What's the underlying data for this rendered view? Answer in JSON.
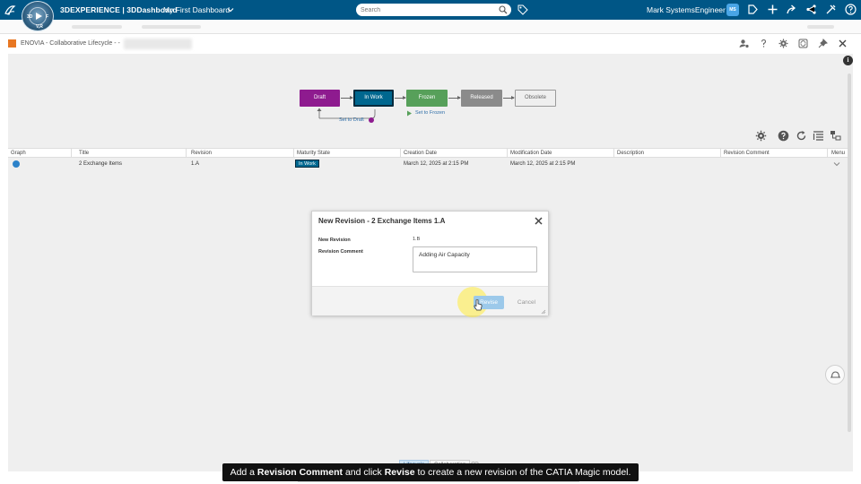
{
  "topbar": {
    "brand": "3DEXPERIENCE | 3DDashboard",
    "dashboard_name": "My First Dashboard",
    "search_placeholder": "Search",
    "username": "Mark SystemsEngineer",
    "avatar_initials": "MS",
    "compass_labels": {
      "left": "3D",
      "right": "F",
      "bottom": "V,R"
    }
  },
  "widget": {
    "title": "ENOVIA - Collaborative Lifecycle - -"
  },
  "lifecycle": {
    "states": [
      "Draft",
      "In Work",
      "Frozen",
      "Released",
      "Obsolete"
    ],
    "current": "In Work",
    "transitions": {
      "to_draft": "Set to Draft",
      "to_frozen": "Set to Frozen"
    }
  },
  "table": {
    "columns": [
      "Graph",
      "Title",
      "Revision",
      "Maturity State",
      "Creation Date",
      "Modification Date",
      "Description",
      "Revision Comment",
      "Menu"
    ],
    "rows": [
      {
        "title": "2 Exchange Items",
        "revision": "1.A",
        "maturity": "In Work",
        "created": "March 12, 2025 at 2:15 PM",
        "modified": "March 12, 2025 at 2:15 PM",
        "description": "",
        "comment": ""
      }
    ]
  },
  "dialog": {
    "title": "New Revision - 2 Exchange Items 1.A",
    "new_revision_label": "New Revision",
    "new_revision_value": "1.B",
    "comment_label": "Revision Comment",
    "comment_value": "Adding Air Capacity",
    "revise_button": "Revise",
    "cancel_button": "Cancel"
  },
  "bottom_tabs": [
    "Lifecycle",
    "Collaboration"
  ],
  "caption": {
    "part1": "Add a ",
    "bold1": "Revision Comment",
    "part2": " and click ",
    "bold2": "Revise",
    "part3": " to create a new revision of the CATIA Magic model."
  },
  "colors": {
    "topbar": "#005686",
    "draft": "#8e1b8f",
    "in_work": "#00678f",
    "frozen": "#57a05a",
    "released": "#8b8b8b",
    "widget_icon": "#e87722"
  }
}
